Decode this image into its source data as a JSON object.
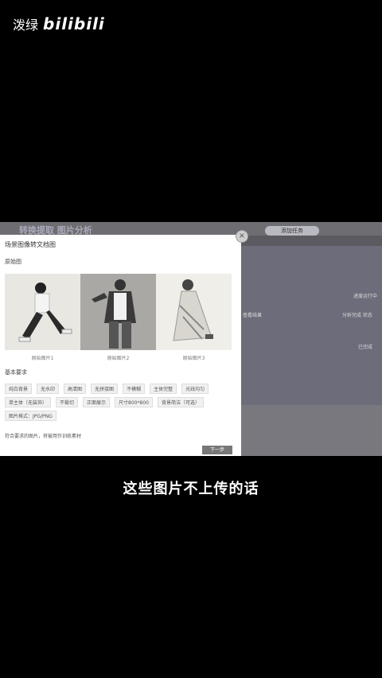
{
  "watermark": {
    "text": "泼绿",
    "logo": "bilibili"
  },
  "background": {
    "title": "转换提取 图片分析",
    "button": "添加任务",
    "rows": [
      "进度运行中",
      "查看结果",
      "分析完成 状态",
      "已完成"
    ]
  },
  "modal": {
    "title": "场景图像转文档图",
    "section_images": "原始图",
    "photos": [
      {
        "caption": "原始图片1"
      },
      {
        "caption": "原始图片2"
      },
      {
        "caption": "原始图片3"
      }
    ],
    "section_tags": "基本要求",
    "tags": [
      "纯白背景",
      "无水印",
      "高清图",
      "无拼接图",
      "不模糊",
      "主体完整",
      "光线均匀",
      "单主体（无装饰）",
      "不裁切",
      "正面展示",
      "尺寸800*800",
      "背景简洁（可选）",
      "图片格式：JPG/PNG"
    ],
    "note": "符合要求的图片，将被用作训练素材",
    "next_label": "下一步",
    "close_label": "×"
  },
  "subtitle": "这些图片不上传的话"
}
